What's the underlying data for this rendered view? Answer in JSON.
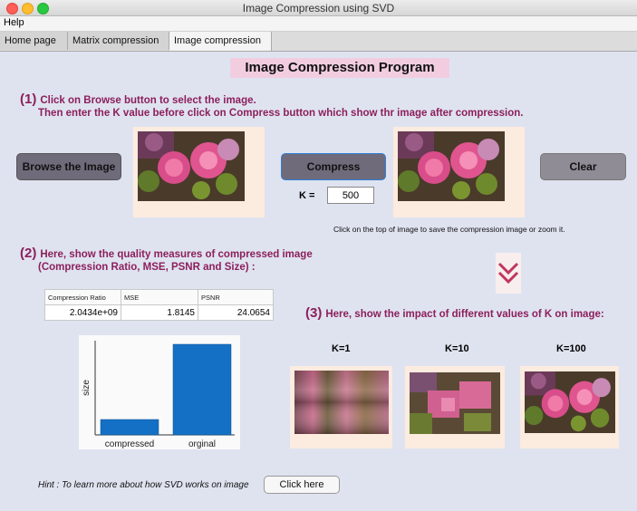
{
  "window": {
    "title": "Image Compression using SVD"
  },
  "menu": {
    "help": "Help"
  },
  "tabs": {
    "home": "Home page",
    "matrix": "Matrix compression",
    "image": "Image compression"
  },
  "heading": "Image Compression Program",
  "step1": {
    "num": "(1)",
    "line1": "Click on Browse button to select the image.",
    "line2": "Then enter the K value before click on Compress button which show thr image after compression."
  },
  "buttons": {
    "browse": "Browse the Image",
    "compress": "Compress",
    "clear": "Clear",
    "click_here": "Click here"
  },
  "k_field": {
    "label": "K =",
    "value": "500"
  },
  "save_note": "Click on the top of image to save the compression image or zoom it.",
  "step2": {
    "num": "(2)",
    "line1": "Here, show the quality measures of compressed image",
    "line2": "(Compression Ratio, MSE, PSNR and Size) :"
  },
  "quality_table": {
    "headers": [
      "Compression Ratio",
      "MSE",
      "PSNR"
    ],
    "values": [
      "2.0434e+09",
      "1.8145",
      "24.0654"
    ]
  },
  "step3": {
    "num": "(3)",
    "text": "Here, show the impact of different values of K on image:"
  },
  "k_images": {
    "k1": "K=1",
    "k10": "K=10",
    "k100": "K=100"
  },
  "chart_data": {
    "type": "bar",
    "categories": [
      "compressed",
      "orginal"
    ],
    "values": [
      17,
      100
    ],
    "ylabel": "size",
    "color": "#1470c4"
  },
  "hint": "Hint : To learn more about how SVD works on image",
  "icons": {
    "chevron": "double-chevron-down-icon"
  }
}
